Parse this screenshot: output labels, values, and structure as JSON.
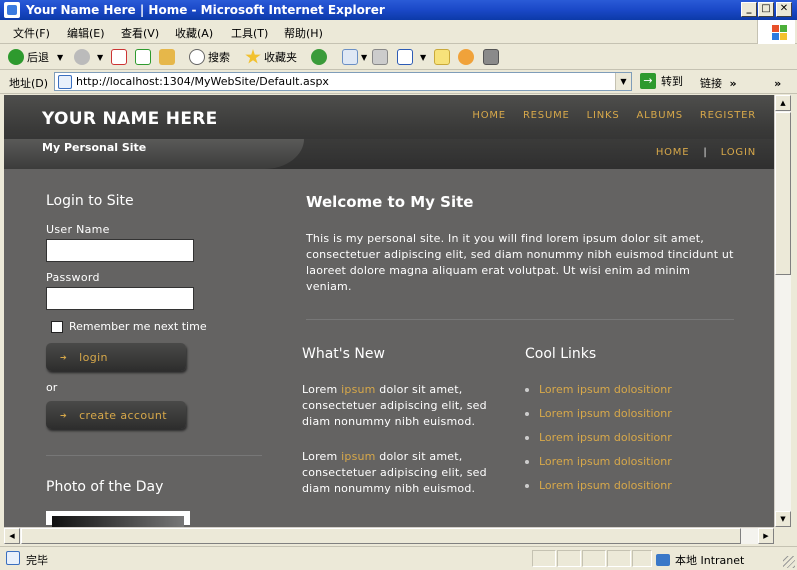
{
  "window": {
    "title": "Your Name Here | Home - Microsoft Internet Explorer",
    "min_glyph": "_",
    "max_glyph": "□",
    "close_glyph": "✕"
  },
  "menu": [
    "文件(F)",
    "编辑(E)",
    "查看(V)",
    "收藏(A)",
    "工具(T)",
    "帮助(H)"
  ],
  "toolbar": {
    "back": "后退",
    "search": "搜索",
    "favorites": "收藏夹"
  },
  "address": {
    "label": "地址(D)",
    "url": "http://localhost:1304/MyWebSite/Default.aspx",
    "go": "转到",
    "links": "链接",
    "chevron": "»"
  },
  "site": {
    "name": "YOUR NAME HERE",
    "tagline": "My Personal Site",
    "topnav": [
      "HOME",
      "RESUME",
      "LINKS",
      "ALBUMS",
      "REGISTER"
    ],
    "subnav": {
      "home": "HOME",
      "sep": "|",
      "login": "LOGIN"
    }
  },
  "login": {
    "heading": "Login to Site",
    "username_label": "User Name",
    "password_label": "Password",
    "remember": "Remember me next time",
    "login_button": "login",
    "or": "or",
    "create_button": "create account",
    "arrow": "➔"
  },
  "photo": {
    "heading": "Photo of the Day"
  },
  "welcome": {
    "heading": "Welcome to My Site",
    "text": "This is my personal site. In it you will find lorem ipsum dolor sit amet, consectetuer adipiscing elit, sed diam nonummy nibh euismod tincidunt ut laoreet dolore magna aliquam erat volutpat. Ut wisi enim ad minim veniam."
  },
  "whats_new": {
    "heading": "What's New",
    "items": [
      {
        "pre": "Lorem ",
        "link": "ipsum",
        "post": " dolor sit amet, consectetuer adipiscing elit, sed diam nonummy nibh euismod."
      },
      {
        "pre": "Lorem ",
        "link": "ipsum",
        "post": " dolor sit amet, consectetuer adipiscing elit, sed diam nonummy nibh euismod."
      }
    ]
  },
  "cool_links": {
    "heading": "Cool Links",
    "items": [
      "Lorem ipsum dolositionr",
      "Lorem ipsum dolositionr",
      "Lorem ipsum dolositionr",
      "Lorem ipsum dolositionr",
      "Lorem ipsum dolositionr"
    ]
  },
  "status": {
    "text": "完毕",
    "zone": "本地 Intranet"
  },
  "colors": {
    "accent_gold": "#d7a84a",
    "page_bg": "#646362",
    "header_bg": "#2b2b2b"
  }
}
